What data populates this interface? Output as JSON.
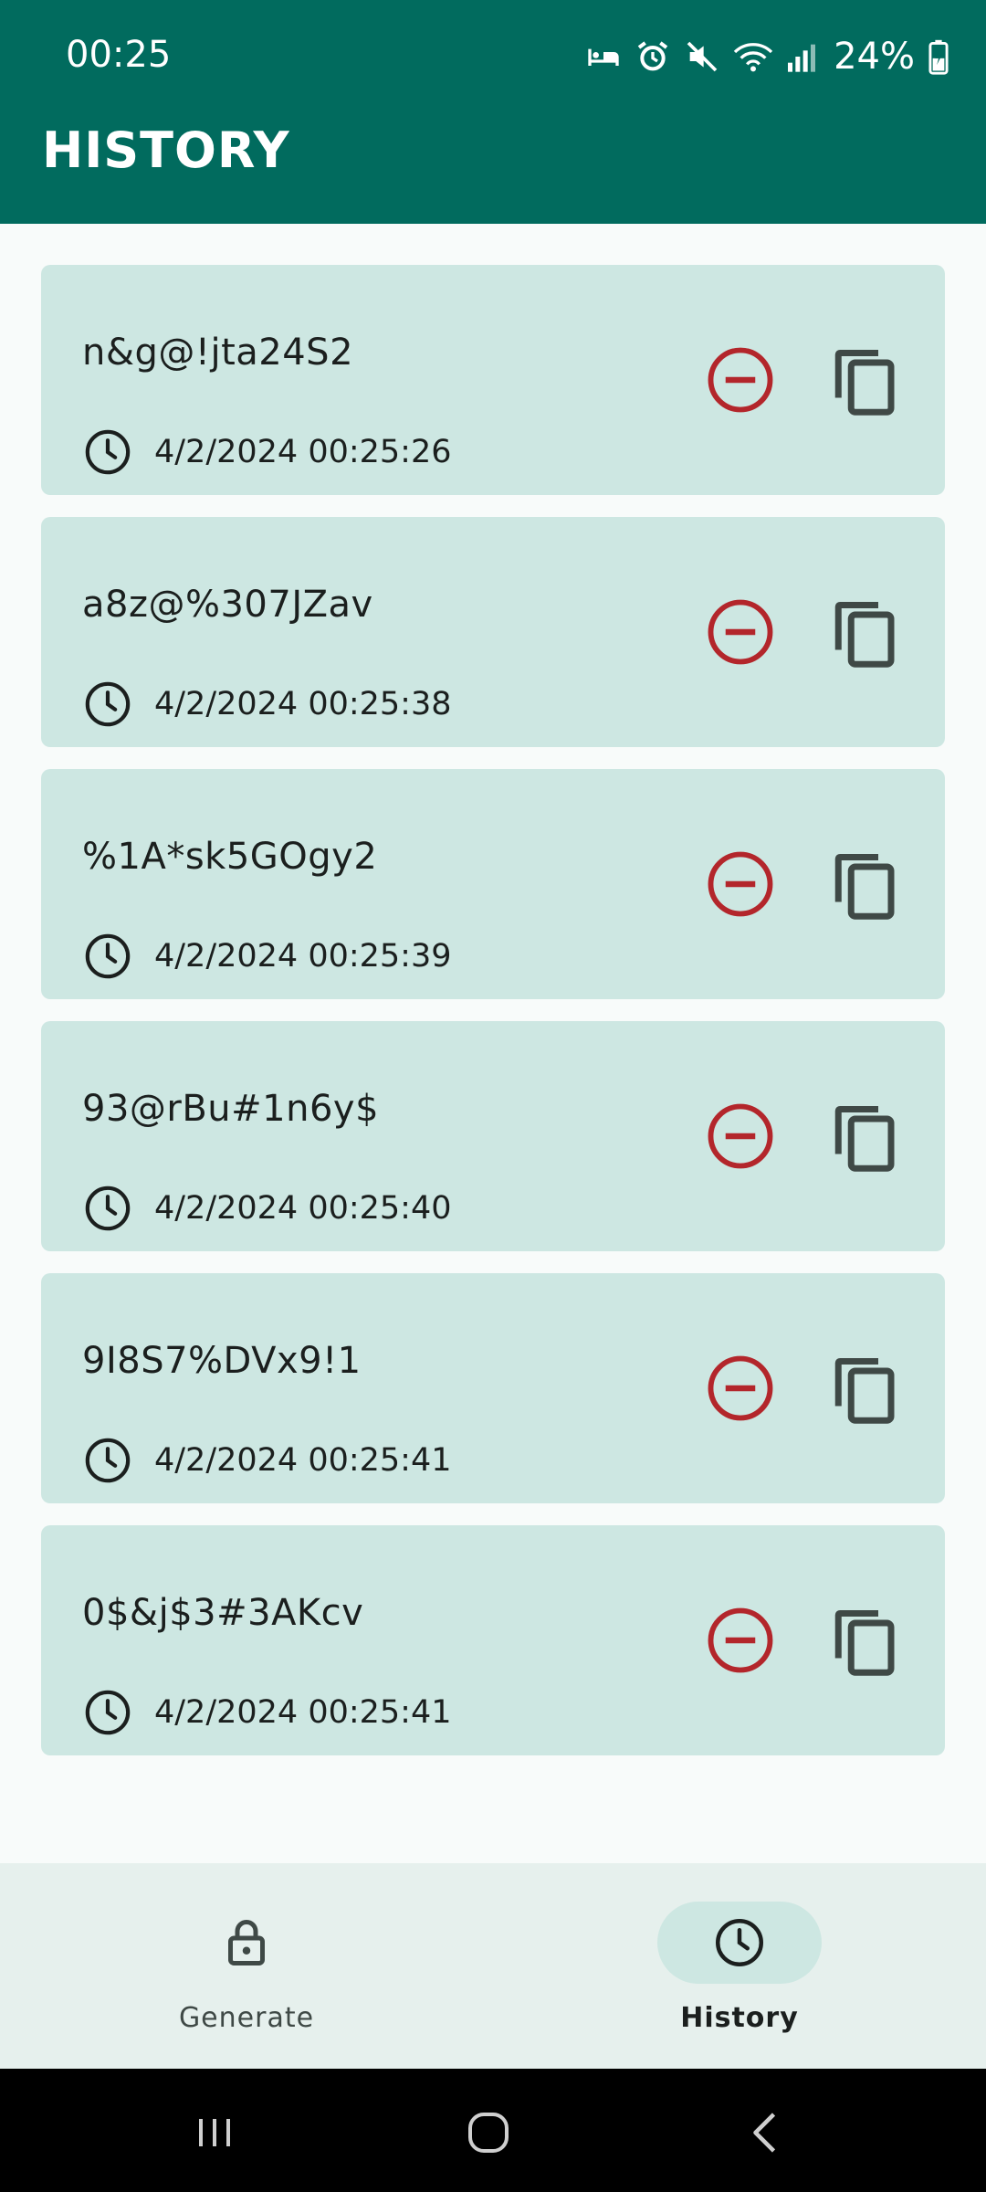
{
  "status_bar": {
    "time": "00:25",
    "battery": "24%",
    "icons": [
      "sleep-mode-icon",
      "alarm-icon",
      "mute-icon",
      "wifi-icon",
      "signal-icon",
      "battery-charging-icon"
    ]
  },
  "header": {
    "title": "HISTORY"
  },
  "history": {
    "items": [
      {
        "password": "n&g@!jta24S2",
        "timestamp": "4/2/2024 00:25:26"
      },
      {
        "password": "a8z@%307JZav",
        "timestamp": "4/2/2024 00:25:38"
      },
      {
        "password": "%1A*sk5GOgy2",
        "timestamp": "4/2/2024 00:25:39"
      },
      {
        "password": "93@rBu#1n6y$",
        "timestamp": "4/2/2024 00:25:40"
      },
      {
        "password": "9I8S7%DVx9!1",
        "timestamp": "4/2/2024 00:25:41"
      },
      {
        "password": "0$&j$3#3AKcv",
        "timestamp": "4/2/2024 00:25:41"
      }
    ]
  },
  "bottom_nav": {
    "items": [
      {
        "label": "Generate",
        "icon": "lock-icon",
        "active": false
      },
      {
        "label": "History",
        "icon": "clock-icon",
        "active": true
      }
    ]
  },
  "colors": {
    "app_bar": "#016b5e",
    "card_bg": "#cde7e2",
    "delete_red": "#b3262b",
    "icon_dark": "#3f4946",
    "nav_bg": "#e6f0ed"
  }
}
